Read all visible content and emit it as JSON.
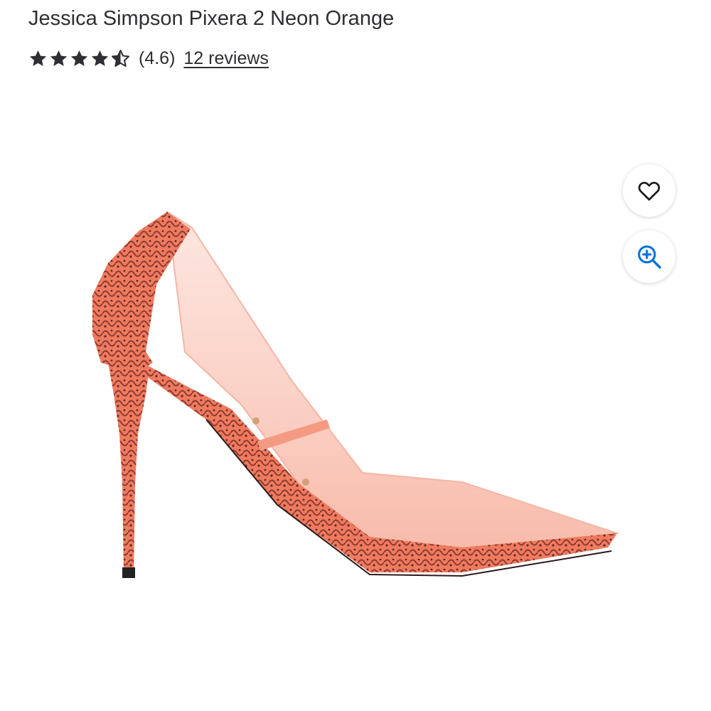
{
  "product": {
    "title": "Jessica Simpson Pixera 2 Neon Orange",
    "rating_value": 4.6,
    "rating_text": "(4.6)",
    "reviews_link": "12 reviews",
    "stars_total": 5
  },
  "icons": {
    "favorite": "heart-icon",
    "zoom": "zoom-in-icon",
    "rating": "star-icon"
  },
  "colors": {
    "text": "#2e2f32",
    "zoom_icon": "#0071dc",
    "shoe_accent": "#f07a5e"
  }
}
